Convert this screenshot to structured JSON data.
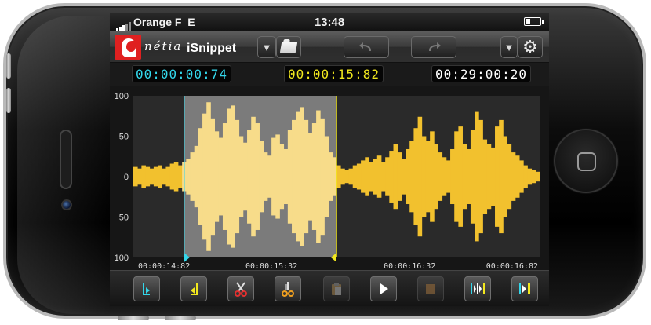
{
  "status_bar": {
    "carrier": "Orange F",
    "network": "E",
    "time": "13:48",
    "battery_level": 0.35
  },
  "toolbar": {
    "brand_script": "nétia",
    "app_title": "iSnippet",
    "icons": [
      "dropdown-arrow-icon",
      "folder-icon",
      "undo-icon",
      "redo-icon",
      "dropdown-arrow-icon",
      "gear-icon"
    ]
  },
  "timecodes": {
    "in_point": "00:00:00:74",
    "current": "00:00:15:82",
    "duration": "00:29:00:20",
    "colors": {
      "in_point": "#33d6ea",
      "current": "#f2e81e",
      "duration": "#ffffff"
    }
  },
  "waveform": {
    "y_ticks": [
      "100",
      "50",
      "0",
      "50",
      "100"
    ],
    "x_ticks": [
      "00:00:14:82",
      "00:00:15:32",
      "00:00:16:32",
      "00:00:16:82"
    ],
    "selection_fraction": [
      0.125,
      0.5
    ],
    "cursor_fraction": 0.5,
    "colors": {
      "wave": "#f2c12e",
      "wave_selected": "#f7dc8a",
      "selection": "#8a8a8a",
      "in_marker": "#33d6ea",
      "cursor": "#f2e81e",
      "background": "#2a2a2a"
    },
    "amplitudes": [
      12,
      10,
      14,
      12,
      10,
      12,
      14,
      10,
      12,
      16,
      18,
      14,
      18,
      22,
      30,
      38,
      60,
      78,
      92,
      72,
      56,
      48,
      66,
      84,
      88,
      70,
      50,
      42,
      58,
      74,
      66,
      44,
      30,
      26,
      48,
      52,
      40,
      34,
      58,
      70,
      80,
      86,
      70,
      54,
      66,
      82,
      72,
      50,
      30,
      24,
      14,
      10,
      8,
      10,
      14,
      16,
      20,
      24,
      18,
      22,
      26,
      18,
      24,
      32,
      40,
      30,
      22,
      34,
      44,
      60,
      74,
      50,
      44,
      56,
      40,
      30,
      24,
      20,
      34,
      56,
      62,
      40,
      34,
      58,
      80,
      70,
      46,
      40,
      36,
      62,
      70,
      50,
      40,
      30,
      26,
      20,
      14,
      10,
      8,
      6
    ]
  },
  "controls": {
    "buttons": [
      {
        "name": "mark-in-button",
        "icon": "mark-in-icon",
        "enabled": true
      },
      {
        "name": "mark-out-button",
        "icon": "mark-out-icon",
        "enabled": true
      },
      {
        "name": "cut-button",
        "icon": "scissors-icon",
        "enabled": true
      },
      {
        "name": "split-button",
        "icon": "split-scissors-icon",
        "enabled": true
      },
      {
        "name": "paste-button",
        "icon": "clipboard-icon",
        "enabled": false
      },
      {
        "name": "play-button",
        "icon": "play-icon",
        "enabled": true
      },
      {
        "name": "stop-button",
        "icon": "stop-icon",
        "enabled": false
      },
      {
        "name": "play-selection-button",
        "icon": "play-selection-icon",
        "enabled": true
      },
      {
        "name": "play-to-end-button",
        "icon": "play-to-end-icon",
        "enabled": true
      }
    ]
  }
}
